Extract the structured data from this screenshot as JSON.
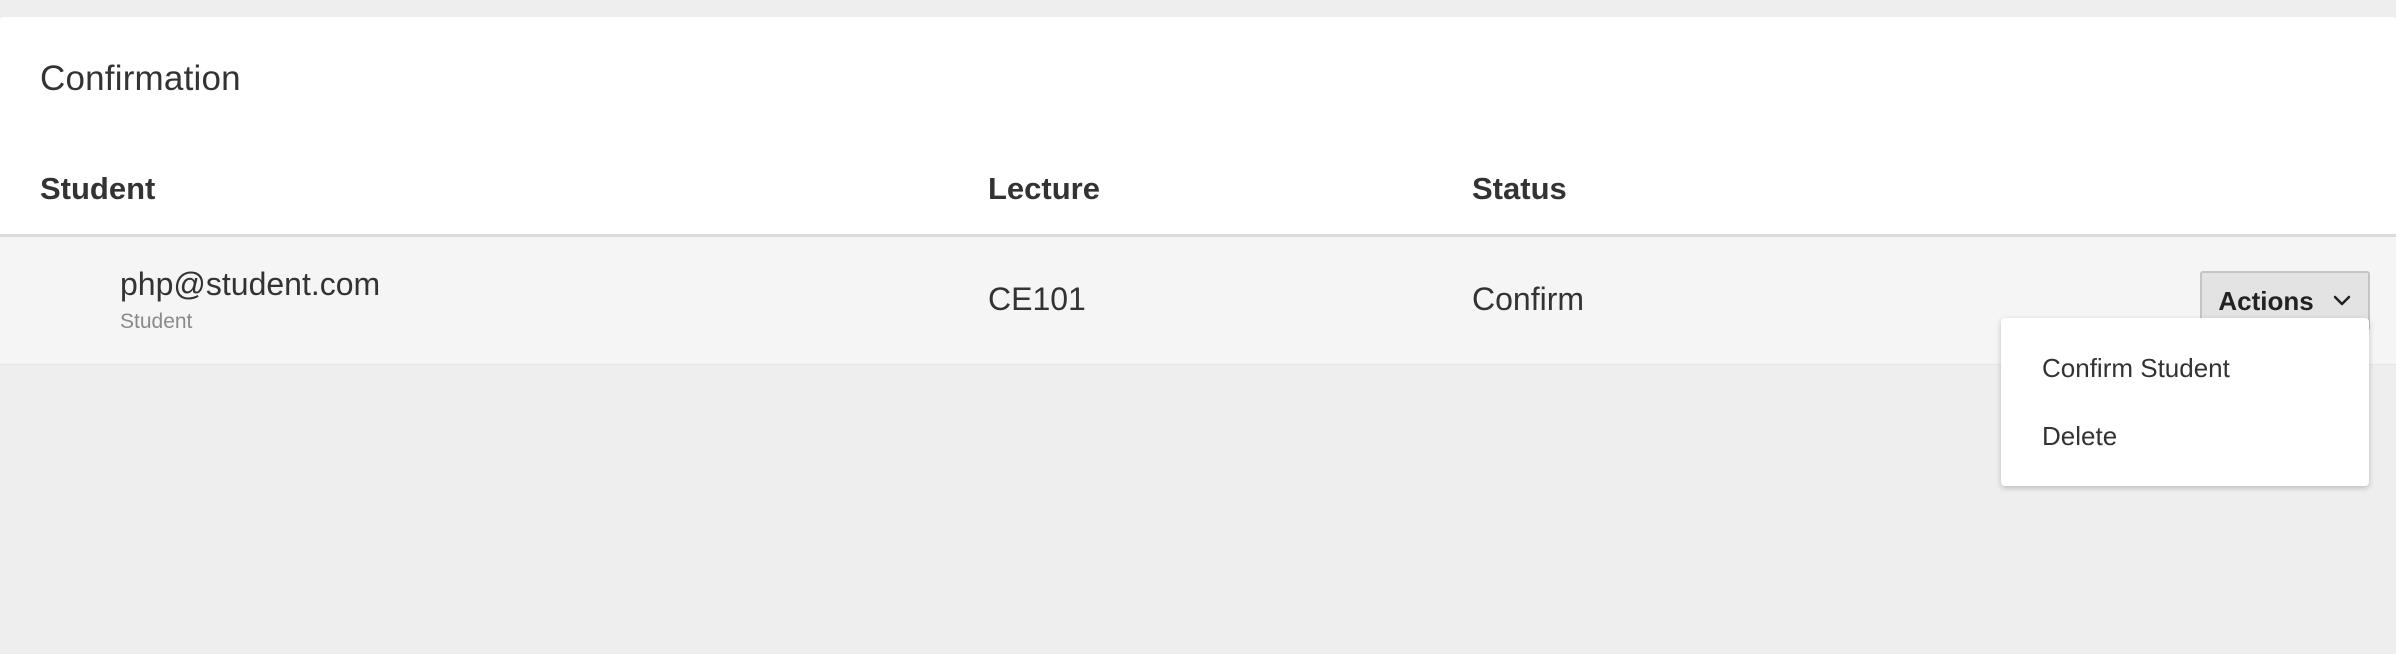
{
  "card": {
    "title": "Confirmation"
  },
  "table": {
    "columns": [
      "Student",
      "Lecture",
      "Status"
    ],
    "rows": [
      {
        "student_email": "php@student.com",
        "student_role": "Student",
        "lecture": "CE101",
        "status": "Confirm"
      }
    ]
  },
  "actions": {
    "button_label": "Actions",
    "button_icon": "chevron-down-icon",
    "menu": [
      "Confirm Student",
      "Delete"
    ]
  }
}
